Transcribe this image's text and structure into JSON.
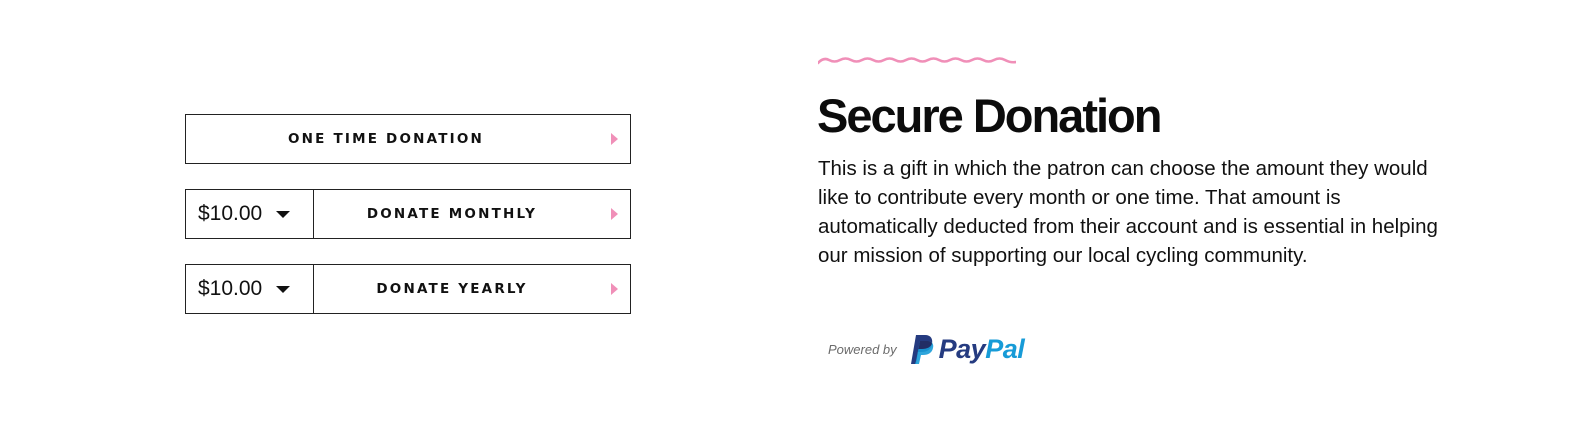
{
  "donation_options": {
    "one_time": {
      "label": "ONE TIME DONATION"
    },
    "monthly": {
      "amount": "$10.00",
      "label": "DONATE MONTHLY"
    },
    "yearly": {
      "amount": "$10.00",
      "label": "DONATE YEARLY"
    }
  },
  "info": {
    "title": "Secure Donation",
    "description": "This is a gift in which the patron can choose the amount they would like to contribute every month or one time. That amount is automatically deducted from their account and is essential in helping our mission of supporting our local cycling community."
  },
  "footer": {
    "powered_by": "Powered by",
    "brand_part1": "Pay",
    "brand_part2": "Pal"
  },
  "icons": {
    "arrow": "play-arrow-icon",
    "caret": "caret-down-icon",
    "squiggle": "wavy-line-icon",
    "paypal": "paypal-logo"
  },
  "colors": {
    "accent_pink": "#f08fb8",
    "paypal_dark_blue": "#253b80",
    "paypal_light_blue": "#179bd7",
    "border": "#222222",
    "text": "#111111"
  }
}
